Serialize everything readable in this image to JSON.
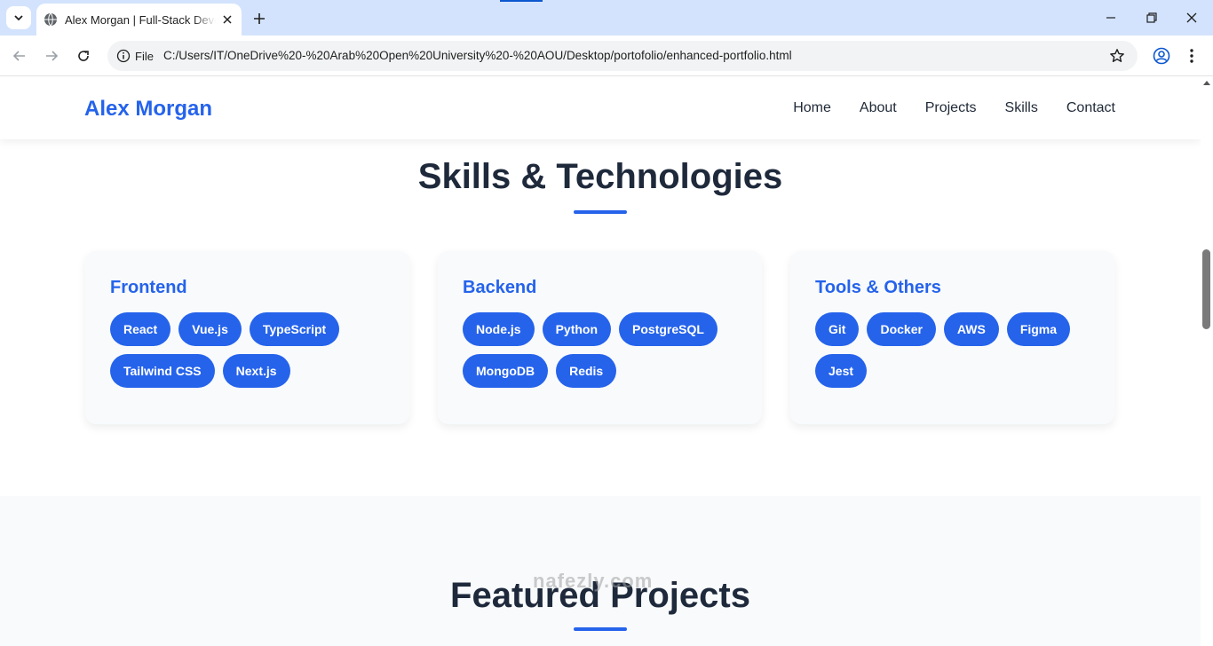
{
  "browser": {
    "tab_title": "Alex Morgan | Full-Stack Developer",
    "chip_label": "File",
    "url": "C:/Users/IT/OneDrive%20-%20Arab%20Open%20University%20-%20AOU/Desktop/portofolio/enhanced-portfolio.html"
  },
  "site": {
    "brand": "Alex Morgan",
    "nav": [
      "Home",
      "About",
      "Projects",
      "Skills",
      "Contact"
    ]
  },
  "skills": {
    "title": "Skills & Technologies",
    "categories": [
      {
        "name": "Frontend",
        "tags": [
          "React",
          "Vue.js",
          "TypeScript",
          "Tailwind CSS",
          "Next.js"
        ]
      },
      {
        "name": "Backend",
        "tags": [
          "Node.js",
          "Python",
          "PostgreSQL",
          "MongoDB",
          "Redis"
        ]
      },
      {
        "name": "Tools & Others",
        "tags": [
          "Git",
          "Docker",
          "AWS",
          "Figma",
          "Jest"
        ]
      }
    ]
  },
  "projects": {
    "title": "Featured Projects"
  },
  "watermark": "nafezly.com",
  "colors": {
    "accent": "#2563eb",
    "heading": "#1e293b",
    "chrome_tabbar": "#d3e3fd"
  }
}
